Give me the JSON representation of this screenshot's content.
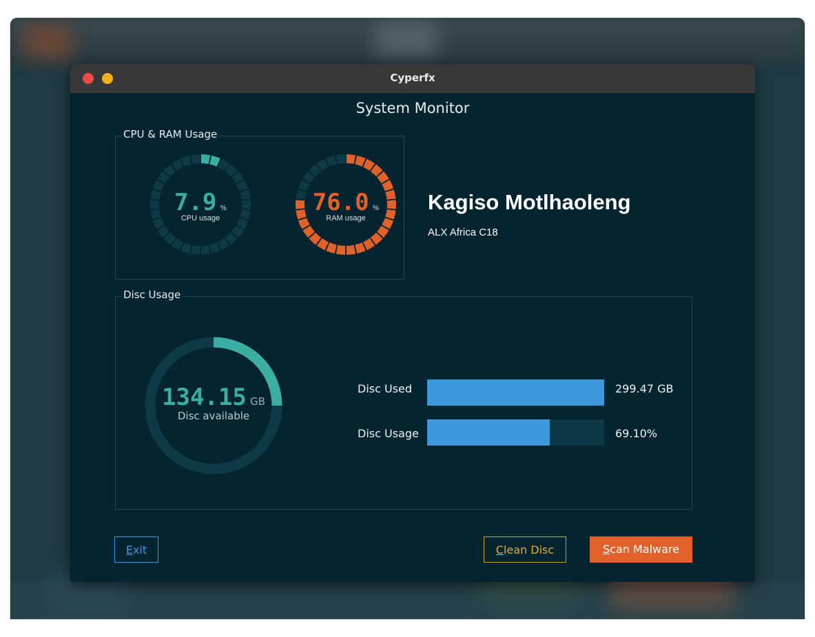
{
  "window": {
    "title": "Cyperfx"
  },
  "app": {
    "title": "System Monitor"
  },
  "cpu_ram": {
    "group_label": "CPU & RAM Usage",
    "cpu": {
      "value": "7.9",
      "unit": "%",
      "caption": "CPU usage",
      "percent": 7.9,
      "color": "#3aaea3"
    },
    "ram": {
      "value": "76.0",
      "unit": "%",
      "caption": "RAM usage",
      "percent": 76.0,
      "color": "#e0612a"
    }
  },
  "user": {
    "name": "Kagiso Motlhaoleng",
    "org": "ALX Africa C18"
  },
  "disc": {
    "group_label": "Disc Usage",
    "available": {
      "value": "134.15",
      "unit": "GB",
      "caption": "Disc available",
      "arc_fraction": 0.25,
      "color": "#3aaea3"
    },
    "used": {
      "label": "Disc Used",
      "value": "299.47 GB",
      "fill": 1.0
    },
    "usage": {
      "label": "Disc Usage",
      "value": "69.10%",
      "fill": 0.691
    }
  },
  "buttons": {
    "exit": {
      "mnemonic": "E",
      "rest": "xit"
    },
    "clean": {
      "mnemonic": "C",
      "rest": "lean Disc"
    },
    "scan": {
      "mnemonic": "S",
      "rest": "can Malware"
    }
  },
  "colors": {
    "bar": "#3d97d8",
    "track": "#0b3a46",
    "accent_orange": "#e0612a",
    "accent_teal": "#3aaea3",
    "bg": "#04242f"
  }
}
